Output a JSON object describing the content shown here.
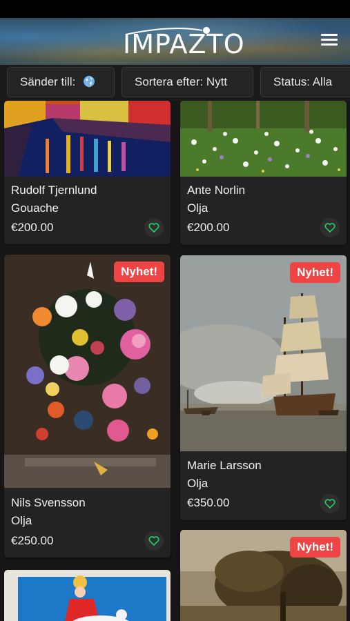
{
  "header": {
    "logo": "IMPAZTO",
    "menu_icon": "hamburger-menu-icon"
  },
  "filters": [
    {
      "label": "Sänder till:",
      "icon": "globe-icon"
    },
    {
      "label": "Sortera efter: Nytt"
    },
    {
      "label": "Status: Alla"
    }
  ],
  "colors": {
    "badge": "#ef4444",
    "heart": "#22c55e",
    "card": "#232323",
    "background": "#161616"
  },
  "cards": [
    {
      "artist": "Rudolf Tjernlund",
      "medium": "Gouache",
      "price": "€200.00",
      "badge": ""
    },
    {
      "artist": "Ante Norlin",
      "medium": "Olja",
      "price": "€200.00",
      "badge": ""
    },
    {
      "artist": "Nils Svensson",
      "medium": "Olja",
      "price": "€250.00",
      "badge": "Nyhet!"
    },
    {
      "artist": "Marie Larsson",
      "medium": "Olja",
      "price": "€350.00",
      "badge": "Nyhet!"
    },
    {
      "artist": "",
      "medium": "",
      "price": "",
      "badge": ""
    },
    {
      "artist": "",
      "medium": "",
      "price": "",
      "badge": "Nyhet!"
    }
  ],
  "favorite_icon": "heart-icon"
}
